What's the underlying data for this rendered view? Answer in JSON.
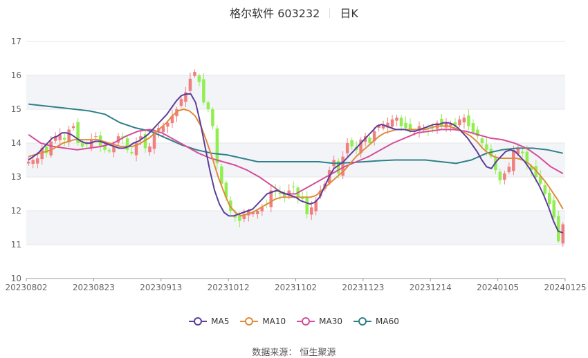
{
  "title": {
    "name": "格尔软件 603232",
    "period": "日K"
  },
  "source": "数据来源：  恒生聚源",
  "colors": {
    "up": "#f08080",
    "down": "#90ee50",
    "MA5": "#5b3e9a",
    "MA10": "#e08a3c",
    "MA30": "#d54c9a",
    "MA60": "#2e8088"
  },
  "chart_data": {
    "type": "candlestick",
    "yaxis": {
      "ticks": [
        10,
        11,
        12,
        13,
        14,
        15,
        16,
        17
      ],
      "min": 10,
      "max": 17
    },
    "xaxis": {
      "ticks": [
        "20230802",
        "20230823",
        "20230913",
        "20231012",
        "20231102",
        "20231123",
        "20231214",
        "20240105",
        "20240125"
      ]
    },
    "grid": "alternating horizontal bands",
    "legend": {
      "position": "bottom",
      "items": [
        "MA5",
        "MA10",
        "MA30",
        "MA60"
      ]
    },
    "bars": 120,
    "closes": [
      13.45,
      13.5,
      13.55,
      13.85,
      13.7,
      14.05,
      14.2,
      14.25,
      14.1,
      14.4,
      14.5,
      14.0,
      13.9,
      13.95,
      14.1,
      14.2,
      13.9,
      13.8,
      13.75,
      13.9,
      14.2,
      14.15,
      13.8,
      13.7,
      14.0,
      14.2,
      13.85,
      13.9,
      14.3,
      14.45,
      14.5,
      14.6,
      14.8,
      15.0,
      15.3,
      15.5,
      15.9,
      16.1,
      15.8,
      15.2,
      15.0,
      14.5,
      13.4,
      12.8,
      12.4,
      12.0,
      11.8,
      11.7,
      11.9,
      12.0,
      11.95,
      12.0,
      12.1,
      12.2,
      12.6,
      12.55,
      12.5,
      12.4,
      12.6,
      12.7,
      12.4,
      12.35,
      11.9,
      12.1,
      12.3,
      12.6,
      12.8,
      13.2,
      13.5,
      13.1,
      13.6,
      14.0,
      13.9,
      13.8,
      14.1,
      14.2,
      14.0,
      14.35,
      14.5,
      14.55,
      14.6,
      14.7,
      14.75,
      14.5,
      14.45,
      14.4,
      14.3,
      14.5,
      14.45,
      14.35,
      14.4,
      14.6,
      14.5,
      14.6,
      14.55,
      14.5,
      14.7,
      14.75,
      14.5,
      14.3,
      14.2,
      14.0,
      13.8,
      13.6,
      13.2,
      12.9,
      13.1,
      13.3,
      13.8,
      13.85,
      13.7,
      13.4,
      13.2,
      13.0,
      12.8,
      12.5,
      12.2,
      11.8,
      11.1,
      11.6
    ],
    "MA5": [
      13.5,
      13.6,
      13.7,
      13.85,
      14.0,
      14.15,
      14.2,
      14.3,
      14.3,
      14.25,
      14.15,
      14.05,
      14.0,
      14.0,
      14.05,
      14.05,
      14.0,
      13.95,
      13.9,
      13.85,
      13.85,
      13.9,
      14.0,
      14.05,
      14.15,
      14.25,
      14.4,
      14.55,
      14.7,
      14.85,
      15.05,
      15.25,
      15.4,
      15.45,
      15.45,
      15.2,
      14.6,
      13.9,
      13.2,
      12.6,
      12.2,
      11.95,
      11.85,
      11.85,
      11.9,
      11.95,
      12.0,
      12.05,
      12.2,
      12.35,
      12.5,
      12.55,
      12.6,
      12.55,
      12.5,
      12.45,
      12.4,
      12.3,
      12.25,
      12.2,
      12.25,
      12.4,
      12.7,
      13.0,
      13.25,
      13.35,
      13.45,
      13.6,
      13.75,
      13.9,
      14.05,
      14.2,
      14.35,
      14.5,
      14.55,
      14.5,
      14.45,
      14.4,
      14.4,
      14.4,
      14.35,
      14.35,
      14.4,
      14.45,
      14.5,
      14.55,
      14.55,
      14.6,
      14.6,
      14.55,
      14.45,
      14.3,
      14.15,
      13.95,
      13.75,
      13.5,
      13.3,
      13.25,
      13.45,
      13.6,
      13.75,
      13.8,
      13.75,
      13.6,
      13.45,
      13.25,
      13.0,
      12.75,
      12.45,
      12.1,
      11.7,
      11.4,
      11.35
    ],
    "MA10": [
      13.6,
      13.65,
      13.7,
      13.75,
      13.8,
      13.9,
      14.0,
      14.05,
      14.1,
      14.1,
      14.1,
      14.1,
      14.1,
      14.05,
      14.0,
      13.95,
      13.9,
      13.9,
      13.9,
      13.95,
      14.05,
      14.15,
      14.3,
      14.45,
      14.6,
      14.8,
      14.95,
      15.0,
      14.95,
      14.8,
      14.5,
      14.05,
      13.55,
      13.0,
      12.55,
      12.15,
      11.95,
      11.85,
      11.9,
      11.95,
      12.05,
      12.15,
      12.25,
      12.35,
      12.4,
      12.4,
      12.4,
      12.4,
      12.4,
      12.4,
      12.45,
      12.6,
      12.75,
      12.9,
      13.05,
      13.2,
      13.4,
      13.6,
      13.75,
      13.9,
      14.05,
      14.2,
      14.3,
      14.35,
      14.4,
      14.4,
      14.4,
      14.4,
      14.4,
      14.4,
      14.45,
      14.5,
      14.5,
      14.5,
      14.45,
      14.4,
      14.3,
      14.2,
      14.05,
      13.85,
      13.7,
      13.6,
      13.55,
      13.55,
      13.55,
      13.55,
      13.5,
      13.4,
      13.25,
      13.05,
      12.85,
      12.6,
      12.35,
      12.05
    ]
  }
}
